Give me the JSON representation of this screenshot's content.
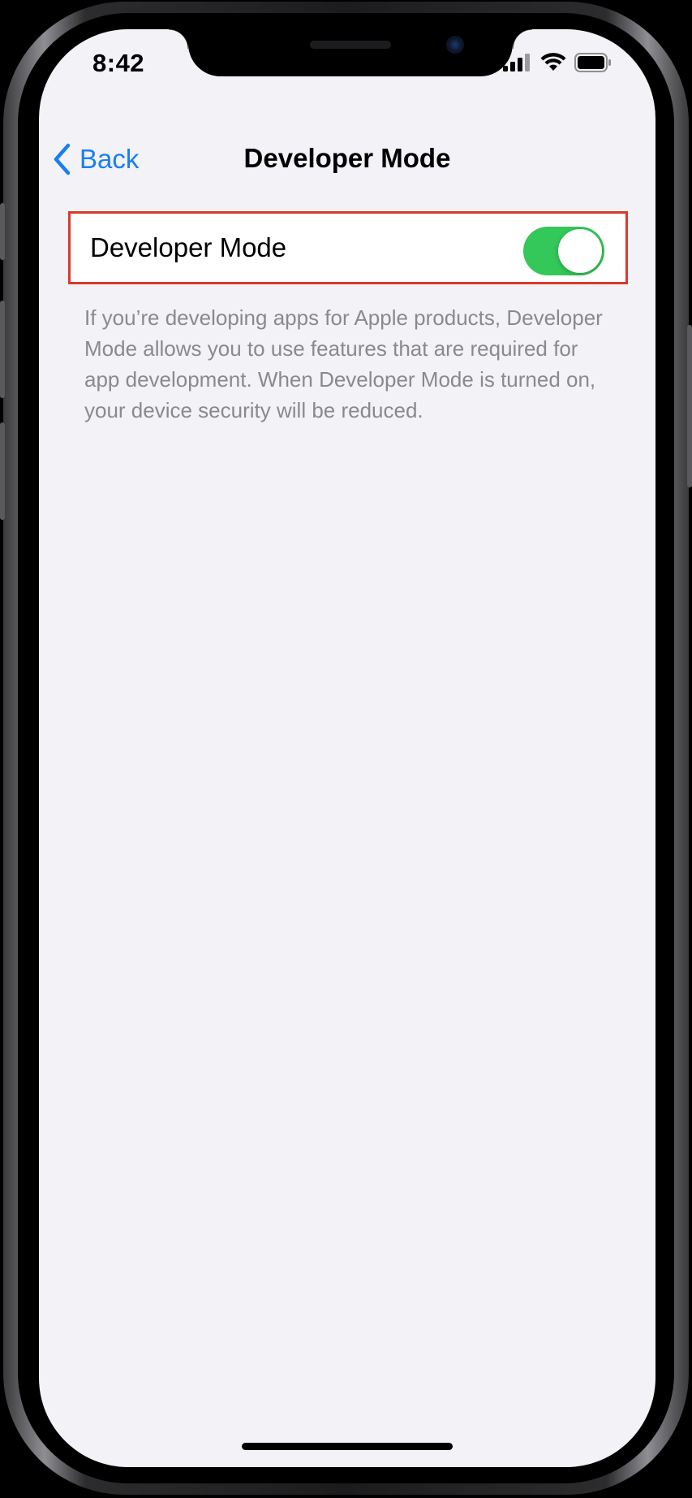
{
  "status_bar": {
    "time": "8:42",
    "icons": [
      "cellular-signal-icon",
      "wifi-icon",
      "battery-icon"
    ]
  },
  "nav": {
    "back_label": "Back",
    "title": "Developer Mode"
  },
  "setting": {
    "label": "Developer Mode",
    "toggle_on": true,
    "footer": "If you’re developing apps for Apple products, Developer Mode allows you to use features that are required for app development. When Developer Mode is turned on, your device security will be reduced."
  },
  "colors": {
    "accent": "#1a7ff0",
    "toggle_on": "#34c759",
    "highlight_border": "#d93a2b",
    "background": "#f2f2f7",
    "footer_text": "#8a8a8e"
  }
}
